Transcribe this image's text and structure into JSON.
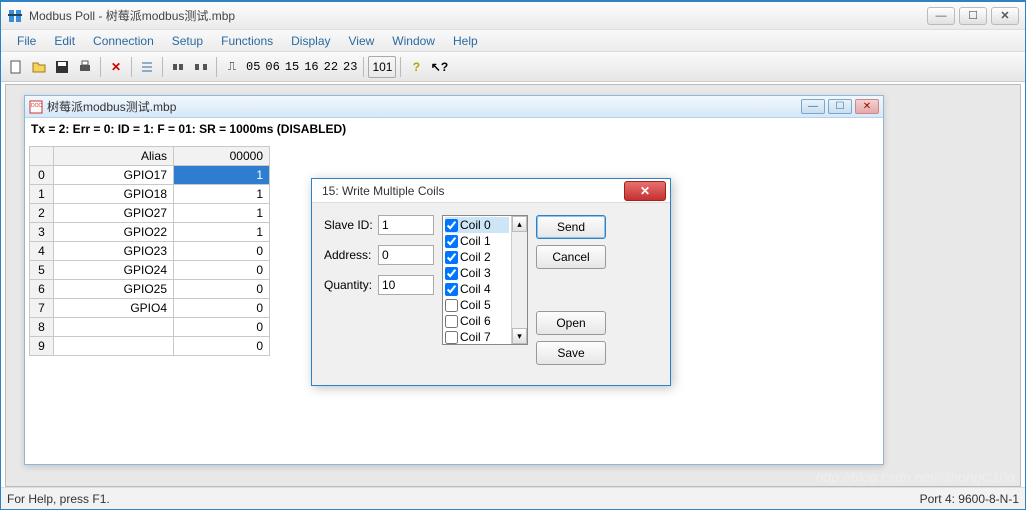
{
  "window": {
    "title": "Modbus Poll - 树莓派modbus测试.mbp",
    "min_icon": "—",
    "max_icon": "☐",
    "close_icon": "✕"
  },
  "menu": [
    "File",
    "Edit",
    "Connection",
    "Setup",
    "Functions",
    "Display",
    "View",
    "Window",
    "Help"
  ],
  "toolbar_nums": [
    "05",
    "06",
    "15",
    "16",
    "22",
    "23"
  ],
  "toolbar_101": "101",
  "mdi": {
    "title": "树莓派modbus测试.mbp",
    "status": "Tx = 2: Err = 0: ID = 1: F = 01: SR = 1000ms  (DISABLED)"
  },
  "grid": {
    "headers": [
      "",
      "Alias",
      "00000"
    ],
    "rows": [
      {
        "idx": "0",
        "alias": "GPIO17",
        "val": "1",
        "selected": true
      },
      {
        "idx": "1",
        "alias": "GPIO18",
        "val": "1"
      },
      {
        "idx": "2",
        "alias": "GPIO27",
        "val": "1"
      },
      {
        "idx": "3",
        "alias": "GPIO22",
        "val": "1"
      },
      {
        "idx": "4",
        "alias": "GPIO23",
        "val": "0"
      },
      {
        "idx": "5",
        "alias": "GPIO24",
        "val": "0"
      },
      {
        "idx": "6",
        "alias": "GPIO25",
        "val": "0"
      },
      {
        "idx": "7",
        "alias": "GPIO4",
        "val": "0"
      },
      {
        "idx": "8",
        "alias": "",
        "val": "0"
      },
      {
        "idx": "9",
        "alias": "",
        "val": "0"
      }
    ]
  },
  "dialog": {
    "title": "15: Write Multiple Coils",
    "slave_label": "Slave ID:",
    "slave_value": "1",
    "address_label": "Address:",
    "address_value": "0",
    "quantity_label": "Quantity:",
    "quantity_value": "10",
    "coils": [
      {
        "label": "Coil 0",
        "checked": true,
        "sel": true
      },
      {
        "label": "Coil 1",
        "checked": true
      },
      {
        "label": "Coil 2",
        "checked": true
      },
      {
        "label": "Coil 3",
        "checked": true
      },
      {
        "label": "Coil 4",
        "checked": true
      },
      {
        "label": "Coil 5",
        "checked": false
      },
      {
        "label": "Coil 6",
        "checked": false
      },
      {
        "label": "Coil 7",
        "checked": false
      }
    ],
    "btn_send": "Send",
    "btn_cancel": "Cancel",
    "btn_open": "Open",
    "btn_save": "Save",
    "close_icon": "✕"
  },
  "status_left": "For Help, press F1.",
  "status_right": "Port 4: 9600-8-N-1",
  "watermark": "http://blog.csdn.net/lilihongC10a"
}
